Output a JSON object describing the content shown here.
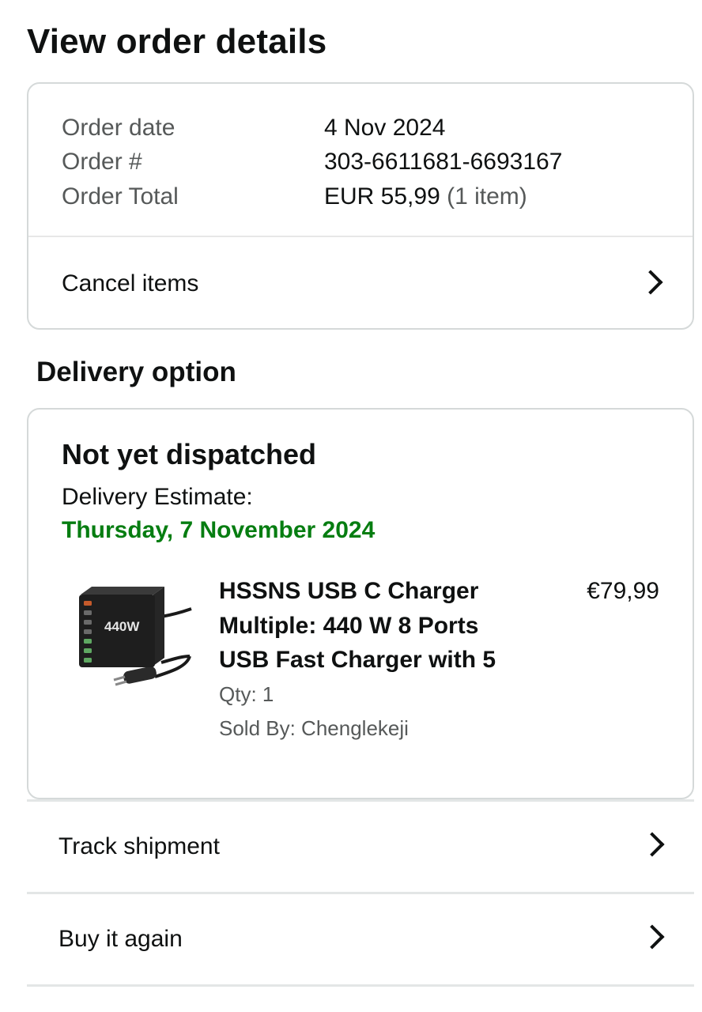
{
  "page": {
    "title": "View order details"
  },
  "summary": {
    "rows": [
      {
        "label": "Order date",
        "value": "4 Nov 2024",
        "extra": ""
      },
      {
        "label": "Order #",
        "value": "303-6611681-6693167",
        "extra": ""
      },
      {
        "label": "Order Total",
        "value": "EUR 55,99",
        "extra": "(1 item)"
      }
    ],
    "cancel_label": "Cancel items"
  },
  "delivery": {
    "section_title": "Delivery option",
    "status": "Not yet dispatched",
    "estimate_label": "Delivery Estimate:",
    "estimate_date": "Thursday, 7 November 2024",
    "estimate_color": "#067d11",
    "item": {
      "title_lines": [
        "HSSNS USB C Charger",
        "Multiple: 440 W 8 Ports",
        "USB Fast Charger with 5"
      ],
      "qty": "Qty: 1",
      "sold_by": "Sold By: Chenglekeji",
      "price": "€79,99",
      "image_badge": "440W"
    }
  },
  "actions": {
    "track_label": "Track shipment",
    "buy_again_label": "Buy it again"
  },
  "icons": {
    "row_chevron": "chevron-right-icon"
  }
}
